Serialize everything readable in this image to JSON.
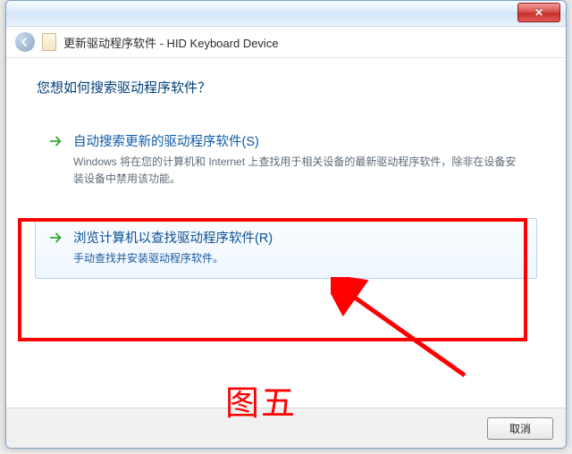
{
  "window": {
    "title": "更新驱动程序软件 - HID Keyboard Device",
    "close_glyph": "✕"
  },
  "heading": "您想如何搜索驱动程序软件？",
  "option_auto": {
    "title": "自动搜索更新的驱动程序软件(S)",
    "desc": "Windows 将在您的计算机和 Internet 上查找用于相关设备的最新驱动程序软件，除非在设备安装设备中禁用该功能。"
  },
  "option_browse": {
    "title": "浏览计算机以查找驱动程序软件(R)",
    "desc": "手动查找并安装驱动程序软件。"
  },
  "figure_label": "图五",
  "buttons": {
    "cancel": "取消"
  }
}
